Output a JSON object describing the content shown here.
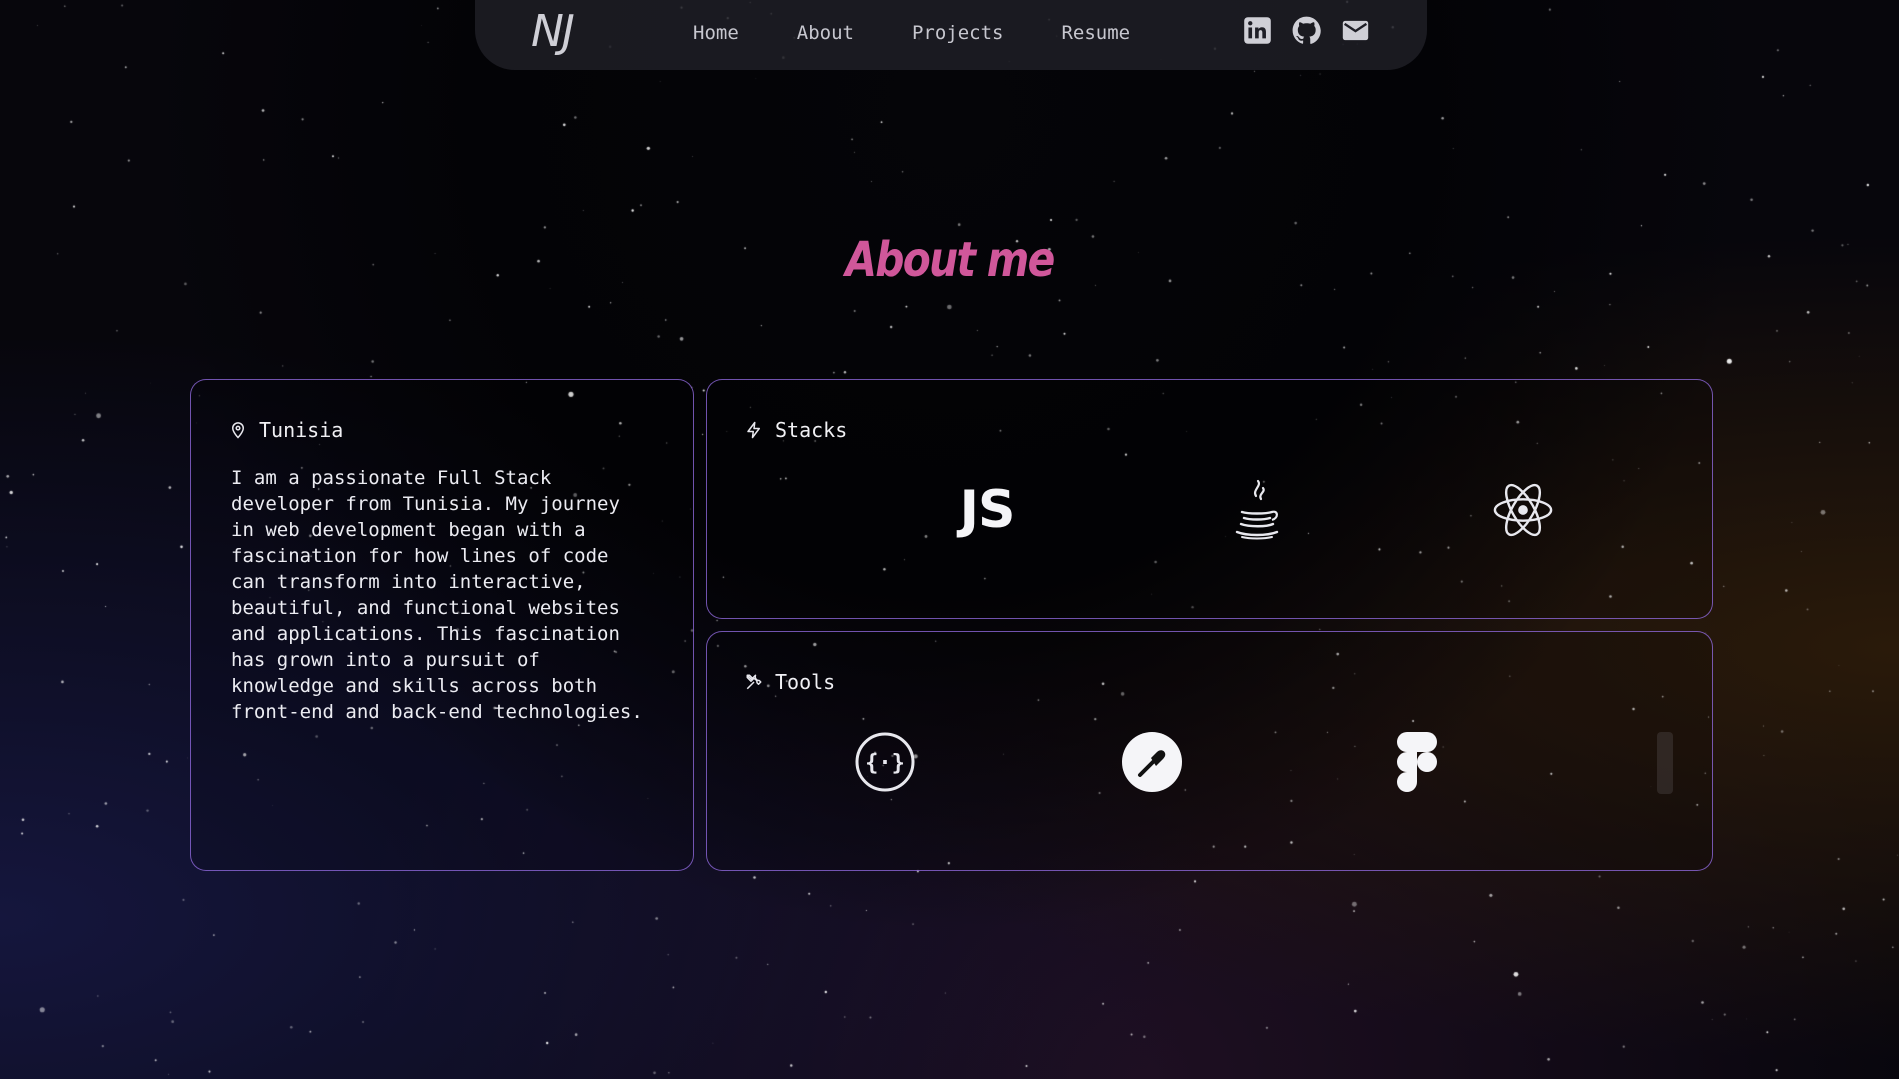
{
  "nav": {
    "logo": "NJ",
    "links": [
      {
        "label": "Home"
      },
      {
        "label": "About"
      },
      {
        "label": "Projects"
      },
      {
        "label": "Resume"
      }
    ],
    "social_icons": [
      "linkedin-icon",
      "github-icon",
      "mail-icon"
    ]
  },
  "about": {
    "title": "About me",
    "location_card": {
      "icon": "map-pin-icon",
      "location": "Tunisia",
      "bio": "I am a passionate Full Stack developer from Tunisia. My journey in web development began with a fascination for how lines of code can transform into interactive, beautiful, and functional websites and applications. This fascination has grown into a pursuit of knowledge and skills across both front-end and back-end technologies."
    },
    "stacks_card": {
      "icon": "lightning-icon",
      "label": "Stacks",
      "items": [
        "javascript-icon",
        "java-icon",
        "react-icon"
      ],
      "js_text": "JS"
    },
    "tools_card": {
      "icon": "tools-icon",
      "label": "Tools",
      "items": [
        "swagger-icon",
        "postman-icon",
        "figma-icon"
      ]
    }
  },
  "colors": {
    "accent_title": "#d0579a",
    "card_border": "#966ee6",
    "text": "#ececf2"
  }
}
